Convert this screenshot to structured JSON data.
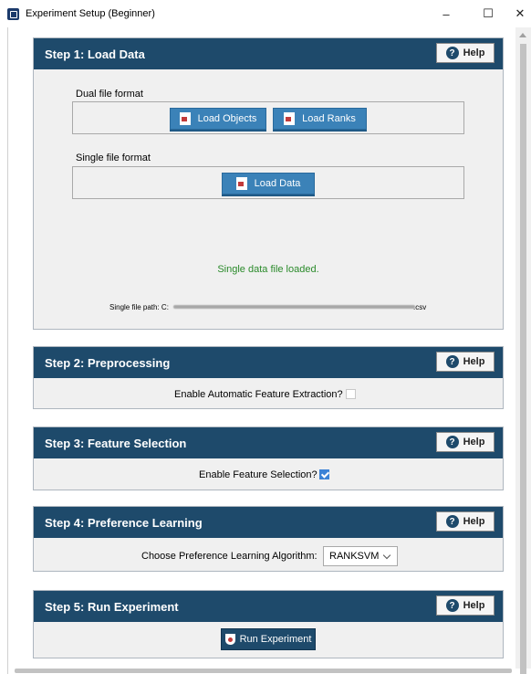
{
  "window": {
    "title": "Experiment Setup (Beginner)",
    "controls": {
      "minimize": "–",
      "maximize": "☐",
      "close": "✕"
    }
  },
  "help_label": "Help",
  "step1": {
    "title": "Step 1: Load Data",
    "dual_label": "Dual file format",
    "load_objects": "Load Objects",
    "load_ranks": "Load Ranks",
    "single_label": "Single file format",
    "load_data": "Load Data",
    "status": "Single data file loaded.",
    "path_label": "Single file path: C:",
    "path_ext": ".csv"
  },
  "step2": {
    "title": "Step 2: Preprocessing",
    "option_label": "Enable Automatic Feature Extraction?",
    "checked": false
  },
  "step3": {
    "title": "Step 3: Feature Selection",
    "option_label": "Enable Feature Selection?",
    "checked": true
  },
  "step4": {
    "title": "Step 4: Preference Learning",
    "option_label": "Choose Preference Learning Algorithm:",
    "algorithm": "RANKSVM"
  },
  "step5": {
    "title": "Step 5: Run Experiment",
    "run_label": "Run Experiment"
  },
  "colors": {
    "header": "#1e4a6b",
    "button": "#3b82b8",
    "status": "#2a8a2a",
    "checkbox": "#3b82d6"
  }
}
